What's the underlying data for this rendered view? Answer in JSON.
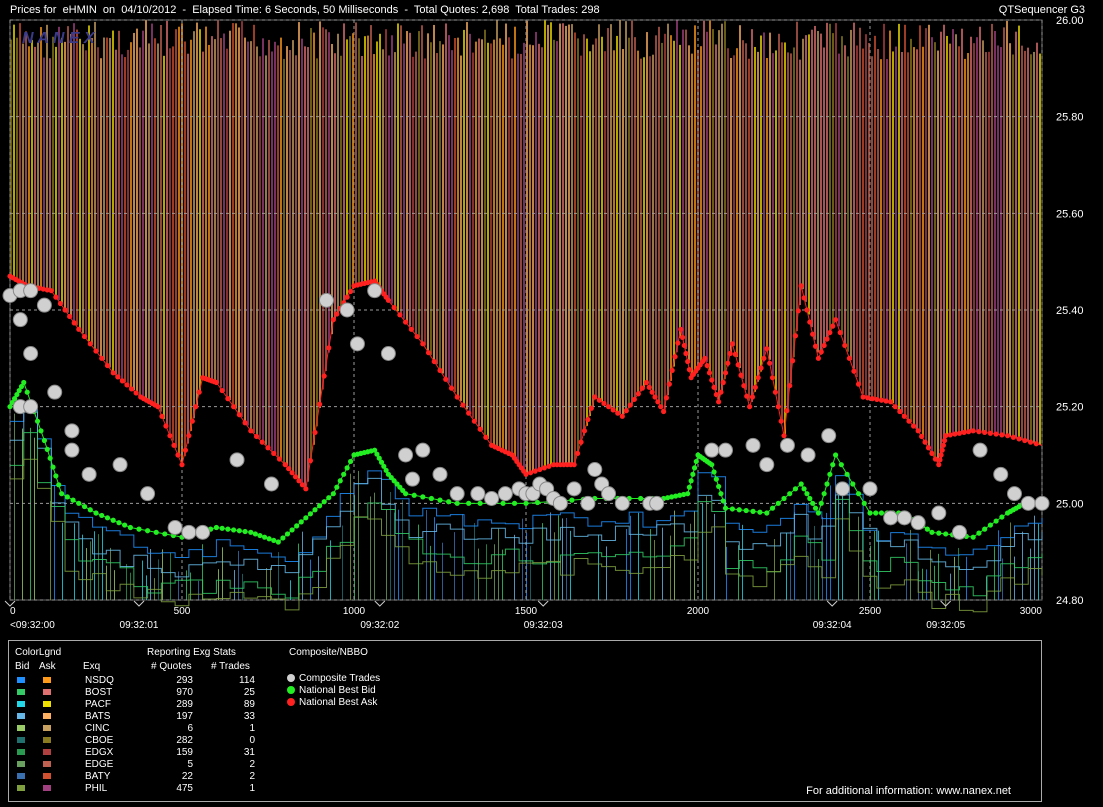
{
  "header": {
    "title": "Prices for  eHMIN  on  04/10/2012  -  Elapsed Time: 6 Seconds, 50 Milliseconds  -  Total Quotes: 2,698  Total Trades: 298",
    "app_name": "QTSequencer G3",
    "watermark": "N A N E X"
  },
  "chart_data": {
    "type": "line",
    "title": "Prices for  eHMIN  on  04/10/2012",
    "xlim": [
      0,
      3000
    ],
    "ylim": [
      24.8,
      26.0
    ],
    "x_ticks": [
      "0",
      "500",
      "1000",
      "1500",
      "2000",
      "2500",
      "3000"
    ],
    "y_ticks": [
      "26.00",
      "25.80",
      "25.60",
      "25.40",
      "25.20",
      "25.00",
      "24.80"
    ],
    "time_ticks": [
      {
        "x": 0,
        "label": "<09:32:00"
      },
      {
        "x": 375,
        "label": "09:32:01"
      },
      {
        "x": 1075,
        "label": "09:32:02"
      },
      {
        "x": 1550,
        "label": "09:32:03"
      },
      {
        "x": 2390,
        "label": "09:32:04"
      },
      {
        "x": 2720,
        "label": "09:32:05"
      }
    ],
    "grid": true,
    "series": [
      {
        "name": "National Best Ask",
        "color": "#ff2020",
        "points": [
          [
            0,
            25.47
          ],
          [
            50,
            25.45
          ],
          [
            120,
            25.44
          ],
          [
            200,
            25.36
          ],
          [
            300,
            25.27
          ],
          [
            380,
            25.22
          ],
          [
            430,
            25.2
          ],
          [
            500,
            25.08
          ],
          [
            560,
            25.26
          ],
          [
            600,
            25.25
          ],
          [
            700,
            25.15
          ],
          [
            800,
            25.08
          ],
          [
            860,
            25.03
          ],
          [
            940,
            25.38
          ],
          [
            1000,
            25.45
          ],
          [
            1060,
            25.46
          ],
          [
            1100,
            25.42
          ],
          [
            1200,
            25.33
          ],
          [
            1300,
            25.22
          ],
          [
            1400,
            25.12
          ],
          [
            1460,
            25.1
          ],
          [
            1500,
            25.06
          ],
          [
            1580,
            25.08
          ],
          [
            1640,
            25.08
          ],
          [
            1700,
            25.22
          ],
          [
            1780,
            25.18
          ],
          [
            1850,
            25.25
          ],
          [
            1900,
            25.19
          ],
          [
            1950,
            25.36
          ],
          [
            1980,
            25.26
          ],
          [
            2020,
            25.3
          ],
          [
            2060,
            25.21
          ],
          [
            2100,
            25.33
          ],
          [
            2150,
            25.2
          ],
          [
            2200,
            25.32
          ],
          [
            2250,
            25.14
          ],
          [
            2300,
            25.45
          ],
          [
            2350,
            25.3
          ],
          [
            2400,
            25.38
          ],
          [
            2480,
            25.22
          ],
          [
            2560,
            25.21
          ],
          [
            2640,
            25.15
          ],
          [
            2700,
            25.08
          ],
          [
            2720,
            25.14
          ],
          [
            2800,
            25.15
          ],
          [
            2900,
            25.14
          ],
          [
            3000,
            25.12
          ]
        ]
      },
      {
        "name": "National Best Bid",
        "color": "#22ee22",
        "points": [
          [
            0,
            25.2
          ],
          [
            40,
            25.25
          ],
          [
            100,
            25.13
          ],
          [
            150,
            25.02
          ],
          [
            250,
            24.98
          ],
          [
            350,
            24.95
          ],
          [
            500,
            24.93
          ],
          [
            600,
            24.95
          ],
          [
            700,
            24.94
          ],
          [
            780,
            24.92
          ],
          [
            860,
            24.97
          ],
          [
            940,
            25.02
          ],
          [
            1000,
            25.1
          ],
          [
            1060,
            25.11
          ],
          [
            1100,
            25.06
          ],
          [
            1150,
            25.02
          ],
          [
            1300,
            25.0
          ],
          [
            1500,
            25.0
          ],
          [
            1700,
            25.01
          ],
          [
            1900,
            25.01
          ],
          [
            1970,
            25.02
          ],
          [
            2000,
            25.1
          ],
          [
            2040,
            25.08
          ],
          [
            2080,
            24.99
          ],
          [
            2200,
            24.98
          ],
          [
            2300,
            25.04
          ],
          [
            2350,
            24.98
          ],
          [
            2400,
            25.1
          ],
          [
            2500,
            24.98
          ],
          [
            2600,
            24.98
          ],
          [
            2680,
            24.94
          ],
          [
            2800,
            24.93
          ],
          [
            2900,
            24.98
          ],
          [
            2950,
            25.0
          ],
          [
            3000,
            25.0
          ]
        ]
      }
    ],
    "composite_trades": [
      [
        0,
        25.43
      ],
      [
        30,
        25.44
      ],
      [
        60,
        25.44
      ],
      [
        100,
        25.41
      ],
      [
        30,
        25.38
      ],
      [
        60,
        25.31
      ],
      [
        30,
        25.2
      ],
      [
        60,
        25.2
      ],
      [
        130,
        25.23
      ],
      [
        180,
        25.15
      ],
      [
        180,
        25.11
      ],
      [
        230,
        25.06
      ],
      [
        320,
        25.08
      ],
      [
        400,
        25.02
      ],
      [
        480,
        24.95
      ],
      [
        520,
        24.94
      ],
      [
        560,
        24.94
      ],
      [
        660,
        25.09
      ],
      [
        760,
        25.04
      ],
      [
        920,
        25.42
      ],
      [
        980,
        25.4
      ],
      [
        1010,
        25.33
      ],
      [
        1060,
        25.44
      ],
      [
        1100,
        25.31
      ],
      [
        1150,
        25.1
      ],
      [
        1170,
        25.05
      ],
      [
        1200,
        25.11
      ],
      [
        1250,
        25.06
      ],
      [
        1300,
        25.02
      ],
      [
        1360,
        25.02
      ],
      [
        1400,
        25.01
      ],
      [
        1440,
        25.02
      ],
      [
        1480,
        25.03
      ],
      [
        1500,
        25.02
      ],
      [
        1520,
        25.02
      ],
      [
        1540,
        25.04
      ],
      [
        1560,
        25.03
      ],
      [
        1580,
        25.01
      ],
      [
        1600,
        25.0
      ],
      [
        1640,
        25.03
      ],
      [
        1680,
        25.0
      ],
      [
        1700,
        25.07
      ],
      [
        1720,
        25.04
      ],
      [
        1740,
        25.02
      ],
      [
        1780,
        25.0
      ],
      [
        1860,
        25.0
      ],
      [
        1880,
        25.0
      ],
      [
        2040,
        25.11
      ],
      [
        2080,
        25.11
      ],
      [
        2160,
        25.12
      ],
      [
        2200,
        25.08
      ],
      [
        2260,
        25.12
      ],
      [
        2320,
        25.1
      ],
      [
        2380,
        25.14
      ],
      [
        2420,
        25.03
      ],
      [
        2500,
        25.03
      ],
      [
        2560,
        24.97
      ],
      [
        2600,
        24.97
      ],
      [
        2640,
        24.96
      ],
      [
        2700,
        24.98
      ],
      [
        2760,
        24.94
      ],
      [
        2820,
        25.11
      ],
      [
        2880,
        25.06
      ],
      [
        2920,
        25.02
      ],
      [
        2960,
        25.0
      ],
      [
        3000,
        25.0
      ]
    ]
  },
  "legend": {
    "color_legend_label": "ColorLgnd",
    "bid_header": "Bid",
    "ask_header": "Ask",
    "exq_header": "Exq",
    "stats_title": "Reporting Exg Stats",
    "quotes_header": "# Quotes",
    "trades_header": "# Trades",
    "composite_title": "Composite/NBBO",
    "composite_items": [
      {
        "label": "Composite Trades",
        "color": "#d0d0d0"
      },
      {
        "label": "National Best Bid",
        "color": "#22ee22"
      },
      {
        "label": "National Best Ask",
        "color": "#ff2020"
      }
    ],
    "rows": [
      {
        "exq": "NSDQ",
        "quotes": "293",
        "trades": "114",
        "bid": "#1e90ff",
        "ask": "#ff9a1a"
      },
      {
        "exq": "BOST",
        "quotes": "970",
        "trades": "25",
        "bid": "#33cc66",
        "ask": "#e07070"
      },
      {
        "exq": "PACF",
        "quotes": "289",
        "trades": "89",
        "bid": "#22d8e8",
        "ask": "#f0e000"
      },
      {
        "exq": "BATS",
        "quotes": "197",
        "trades": "33",
        "bid": "#66b8e8",
        "ask": "#ffb060"
      },
      {
        "exq": "CINC",
        "quotes": "6",
        "trades": "1",
        "bid": "#99cc66",
        "ask": "#c8a060"
      },
      {
        "exq": "CBOE",
        "quotes": "282",
        "trades": "0",
        "bid": "#207070",
        "ask": "#8a7a20"
      },
      {
        "exq": "EDGX",
        "quotes": "159",
        "trades": "31",
        "bid": "#2a9a50",
        "ask": "#b04040"
      },
      {
        "exq": "EDGE",
        "quotes": "5",
        "trades": "2",
        "bid": "#6aa060",
        "ask": "#c06050"
      },
      {
        "exq": "BATY",
        "quotes": "22",
        "trades": "2",
        "bid": "#3a70b0",
        "ask": "#d05030"
      },
      {
        "exq": "PHIL",
        "quotes": "475",
        "trades": "1",
        "bid": "#80a040",
        "ask": "#a04080"
      }
    ],
    "footer": "For additional information: www.nanex.net"
  }
}
